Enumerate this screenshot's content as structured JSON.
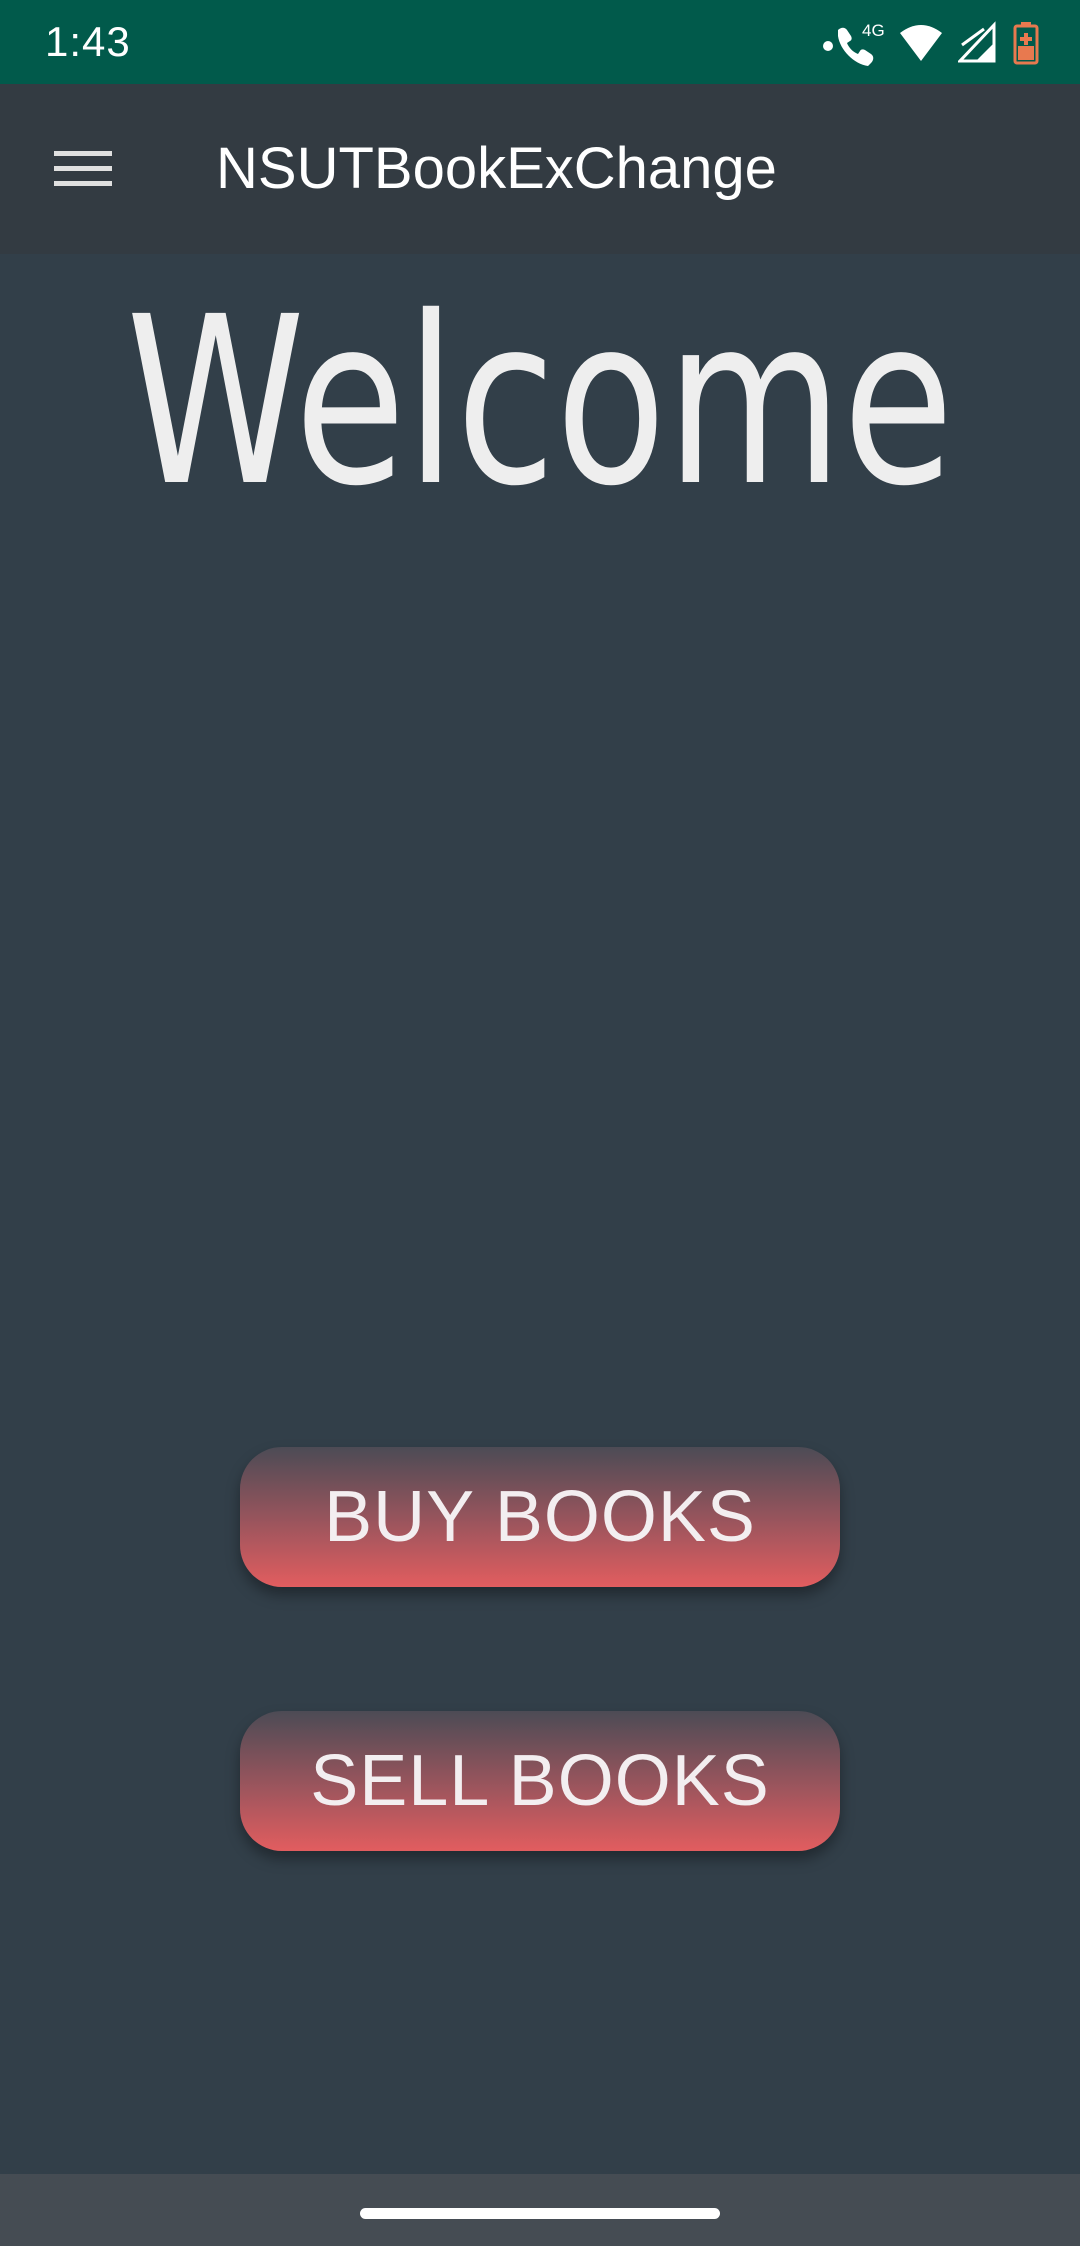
{
  "status_bar": {
    "time": "1:43",
    "network_label": "4G",
    "icons": [
      "call-icon",
      "wifi-icon",
      "signal-icon",
      "battery-icon"
    ],
    "background_color": "#015a4b",
    "battery_color": "#e8794f"
  },
  "app_bar": {
    "title": "NSUTBookExChange",
    "menu_icon": "hamburger-menu-icon",
    "background_color": "#333b42"
  },
  "main": {
    "heading": "Welcome",
    "background_color": "#323f49",
    "buttons": [
      {
        "label": "BUY BOOKS"
      },
      {
        "label": "SELL BOOKS"
      }
    ],
    "button_gradient": [
      "#4c4b55",
      "#e25d5f"
    ]
  },
  "nav_bar": {
    "background_color": "#454c53"
  }
}
